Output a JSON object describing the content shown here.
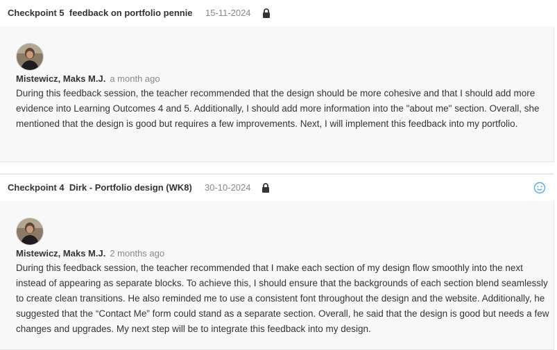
{
  "posts": [
    {
      "checkpoint": "Checkpoint 5",
      "title": "feedback on portfolio pennie",
      "date": "15-11-2024",
      "author": "Mistewicz, Maks M.J.",
      "time": "a month ago",
      "body": "During this feedback session, the teacher recommended that the design should be more cohesive and that I should add more evidence into Learning Outcomes 4 and 5. Additionally, I should add more information into the \"about me\" section. Overall, she mentioned that the design is good but requires a few improvements. Next, I will implement this feedback into my portfolio."
    },
    {
      "checkpoint": "Checkpoint 4",
      "title": "Dirk - Portfolio design (WK8)",
      "date": "30-10-2024",
      "author": "Mistewicz, Maks M.J.",
      "time": "2 months ago",
      "body": "During this feedback session, the teacher recommended that I make each section of my design flow smoothly into the next instead of appearing as separate blocks. To achieve this, I should ensure that the backgrounds of each section blend seamlessly to create clean transitions. He also reminded me to use a consistent font throughout the design and the website. Additionally, he suggested that the “Contact Me” form could stand as a separate section. Overall, he said that the design is good but needs a few changes and upgrades. My next step will be to integrate this feedback into my design."
    }
  ],
  "icons": {
    "lock": "lock-icon",
    "reaction": "smiley-icon"
  },
  "colors": {
    "accent": "#5ba8dc",
    "muted": "#888888",
    "body_bg": "#f8f8f8"
  }
}
